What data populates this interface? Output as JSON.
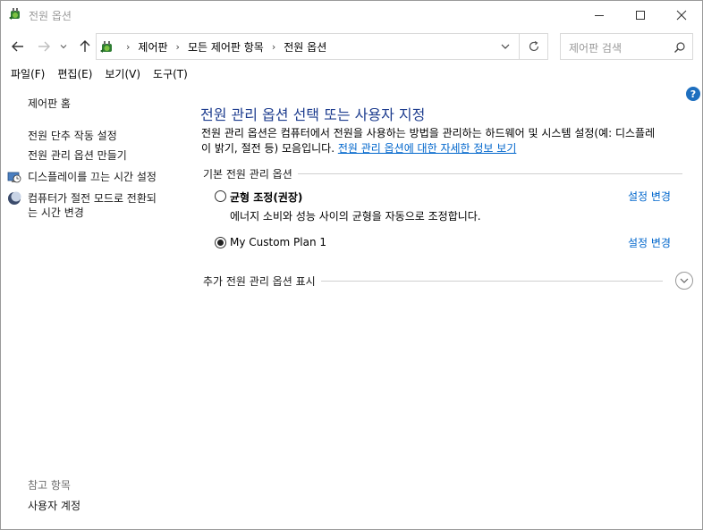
{
  "window": {
    "title": "전원 옵션",
    "minimize_icon": "minimize-icon",
    "maximize_icon": "maximize-icon",
    "close_icon": "close-icon"
  },
  "address": {
    "crumbs": [
      "제어판",
      "모든 제어판 항목",
      "전원 옵션"
    ],
    "search_placeholder": "제어판 검색"
  },
  "menu": {
    "items": [
      "파일(F)",
      "편집(E)",
      "보기(V)",
      "도구(T)"
    ]
  },
  "left_pane": {
    "home": "제어판 홈",
    "links": [
      "전원 단추 작동 설정",
      "전원 관리 옵션 만들기",
      "디스플레이를 끄는 시간 설정",
      "컴퓨터가 절전 모드로 전환되",
      "는 시간 변경"
    ],
    "see_also_label": "참고 항목",
    "user_accounts": "사용자 계정"
  },
  "main": {
    "heading": "전원 관리 옵션 선택 또는 사용자 지정",
    "description_line1": "전원 관리 옵션은 컴퓨터에서 전원을 사용하는 방법을 관리하는 하드웨어 및 시스템 설정(예: 디스플레",
    "description_line2_prefix": "이 밝기, 절전 등) 모음입니다. ",
    "description_link": "전원 관리 옵션에 대한 자세한 정보 보기",
    "preferred_section": "기본 전원 관리 옵션",
    "plans": [
      {
        "name": "균형 조정(권장)",
        "description": "에너지 소비와 성능 사이의 균형을 자동으로 조정합니다.",
        "change_link": "설정 변경",
        "selected": false
      },
      {
        "name": "My Custom Plan 1",
        "description": "",
        "change_link": "설정 변경",
        "selected": true
      }
    ],
    "more_section": "추가 전원 관리 옵션 표시"
  }
}
